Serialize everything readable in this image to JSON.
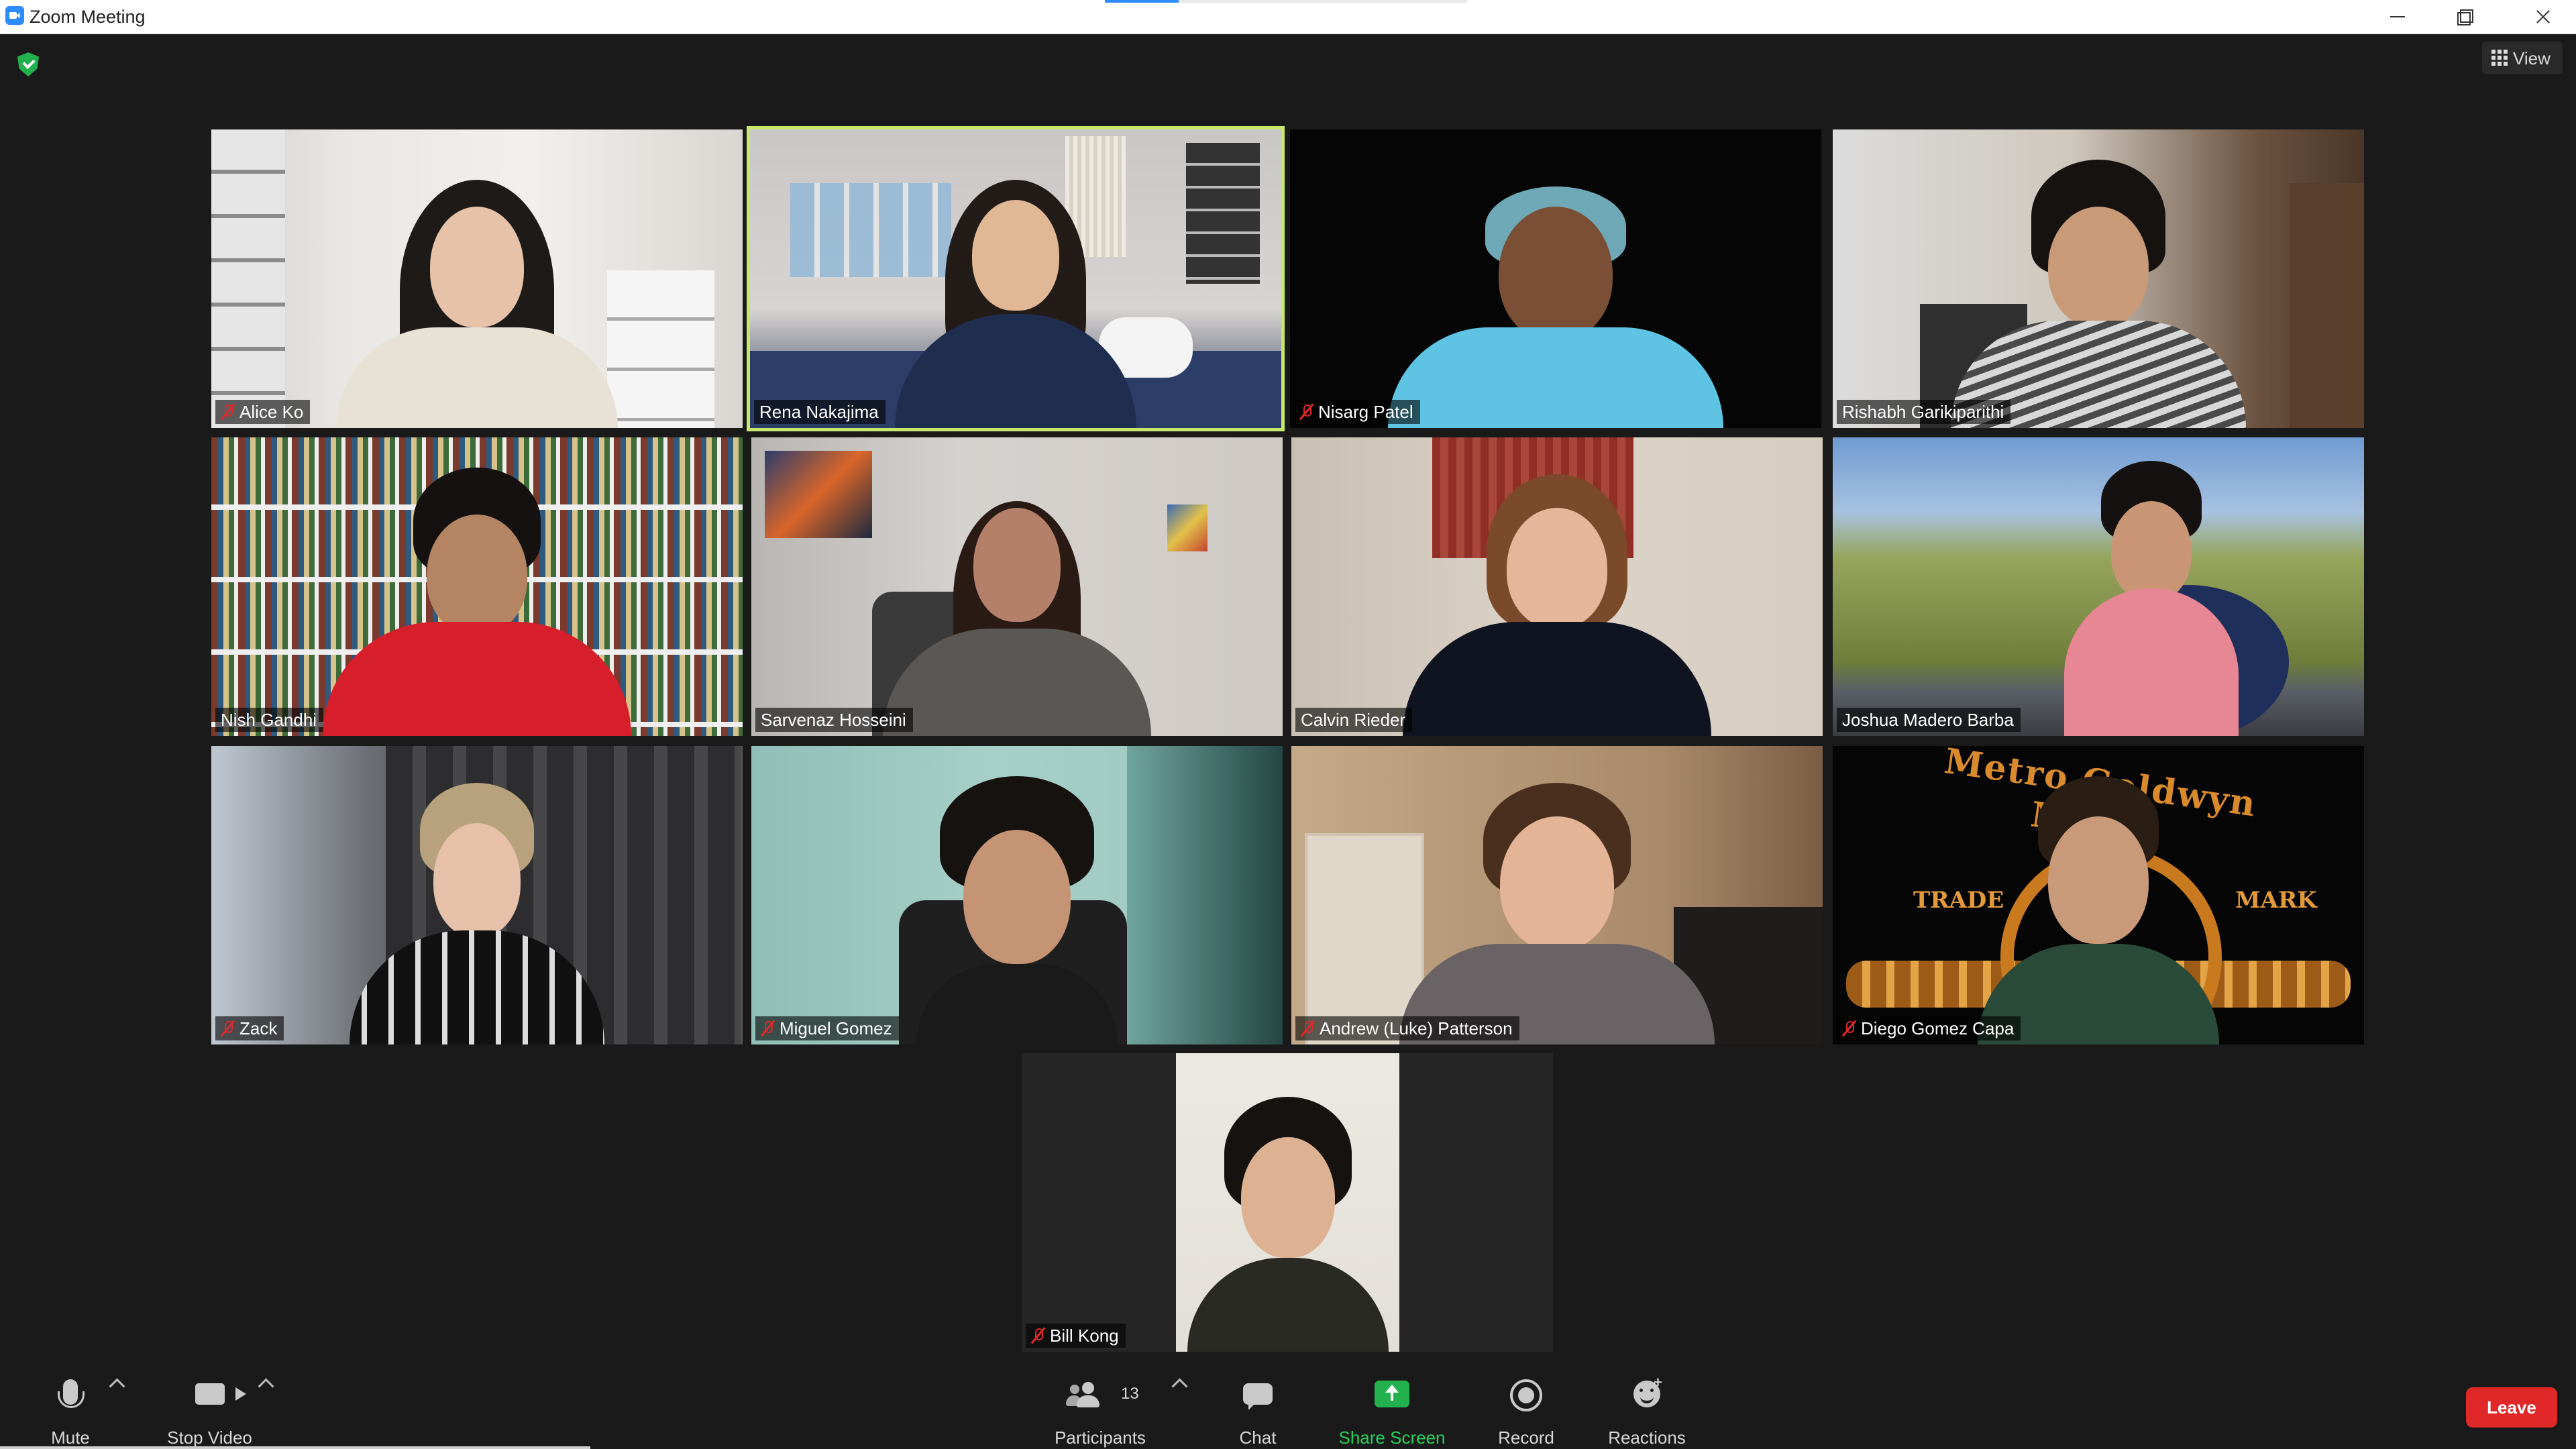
{
  "window": {
    "title": "Zoom Meeting"
  },
  "header": {
    "view_label": "View"
  },
  "participants": [
    {
      "name": "Alice Ko",
      "muted": true
    },
    {
      "name": "Rena Nakajima",
      "muted": false,
      "active_speaker": true
    },
    {
      "name": "Nisarg Patel",
      "muted": true
    },
    {
      "name": "Rishabh Garikiparithi",
      "muted": false
    },
    {
      "name": "Nish Gandhi",
      "muted": false
    },
    {
      "name": "Sarvenaz Hosseini",
      "muted": false
    },
    {
      "name": "Calvin Rieder",
      "muted": false
    },
    {
      "name": "Joshua Madero Barba",
      "muted": false
    },
    {
      "name": "Zack",
      "muted": true
    },
    {
      "name": "Miguel Gomez",
      "muted": true
    },
    {
      "name": "Andrew (Luke) Patterson",
      "muted": true
    },
    {
      "name": "Diego Gomez Capa",
      "muted": true
    },
    {
      "name": "Bill Kong",
      "muted": true
    }
  ],
  "backdrop": {
    "top_text": "Metro Goldwyn Mayer",
    "left_text": "TRADE",
    "right_text": "MARK"
  },
  "toolbar": {
    "mute_label": "Mute",
    "stop_video_label": "Stop Video",
    "participants_label": "Participants",
    "participants_count": "13",
    "chat_label": "Chat",
    "share_screen_label": "Share Screen",
    "record_label": "Record",
    "reactions_label": "Reactions",
    "leave_label": "Leave"
  },
  "colors": {
    "share_green": "#23b14d",
    "leave_red": "#e02828",
    "active_speaker_outline": "#c7e86a",
    "muted_icon": "#e02828"
  },
  "icons": [
    "zoom-app-icon",
    "security-shield-icon",
    "grid-view-icon",
    "mic-icon",
    "video-camera-icon",
    "participants-icon",
    "chat-icon",
    "share-screen-icon",
    "record-icon",
    "reactions-icon",
    "muted-mic-icon"
  ]
}
